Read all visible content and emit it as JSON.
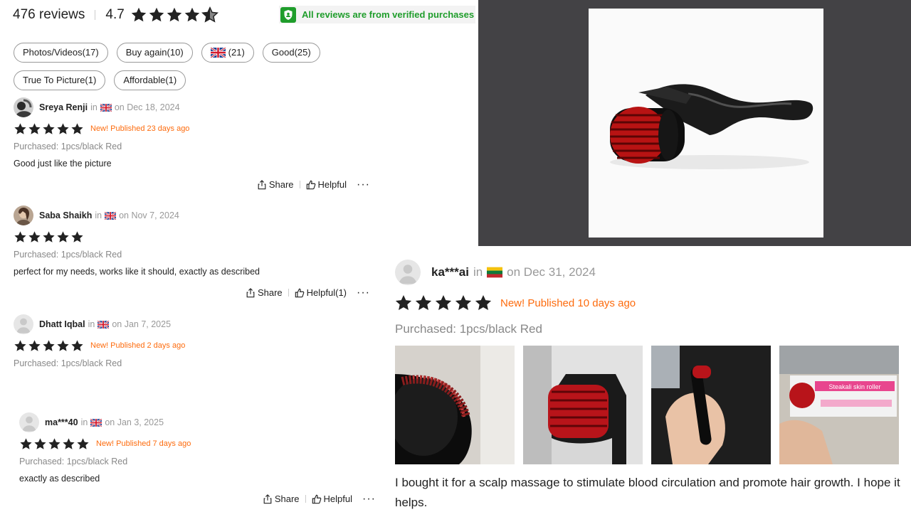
{
  "summary": {
    "reviews": "476 reviews",
    "rating": "4.7",
    "stars": 4.7,
    "verified": "All reviews are from verified purchases"
  },
  "chips": {
    "row1": [
      "Photos/Videos(17)",
      "Buy again(10)",
      "(21)",
      "Good(25)"
    ],
    "row2": [
      "True To Picture(1)",
      "Affordable(1)"
    ]
  },
  "reviews": [
    {
      "name": "Sreya Renji",
      "in": "in",
      "date": "on Dec 18, 2024",
      "stars": 5,
      "new_published": "New! Published 23 days ago",
      "purchased": "Purchased: 1pcs/black Red",
      "text": "Good just like the picture",
      "share": "Share",
      "helpful": "Helpful",
      "more": "···"
    },
    {
      "name": "Saba Shaikh",
      "in": "in",
      "date": "on Nov 7, 2024",
      "stars": 5,
      "new_published": "",
      "purchased": "Purchased: 1pcs/black Red",
      "text": "perfect for my needs, works like it should, exactly as described",
      "share": "Share",
      "helpful": "Helpful(1)",
      "more": "···"
    },
    {
      "name": "Dhatt Iqbal",
      "in": "in",
      "date": "on Jan 7, 2025",
      "stars": 5,
      "new_published": "New! Published 2 days ago",
      "purchased": "Purchased: 1pcs/black Red",
      "text": ""
    },
    {
      "name": "ma***40",
      "in": "in",
      "date": "on Jan 3, 2025",
      "stars": 5,
      "new_published": "New! Published 7 days ago",
      "purchased": "Purchased: 1pcs/black Red",
      "text": "exactly as described",
      "share": "Share",
      "helpful": "Helpful",
      "more": "···"
    }
  ],
  "big_review": {
    "name": "ka***ai",
    "in": "in",
    "date": "on Dec 31, 2024",
    "stars": 5,
    "new_published": "New! Published 10 days ago",
    "purchased": "Purchased: 1pcs/black Red",
    "box_label": "Steakali skin roller",
    "text": "I bought it for a scalp massage to stimulate blood circulation and promote hair growth. I hope it helps."
  },
  "colors": {
    "star": "#222222",
    "accent_orange": "#fd6b0d",
    "verified_green": "#1f9d2b",
    "product_bg": "#434245"
  }
}
